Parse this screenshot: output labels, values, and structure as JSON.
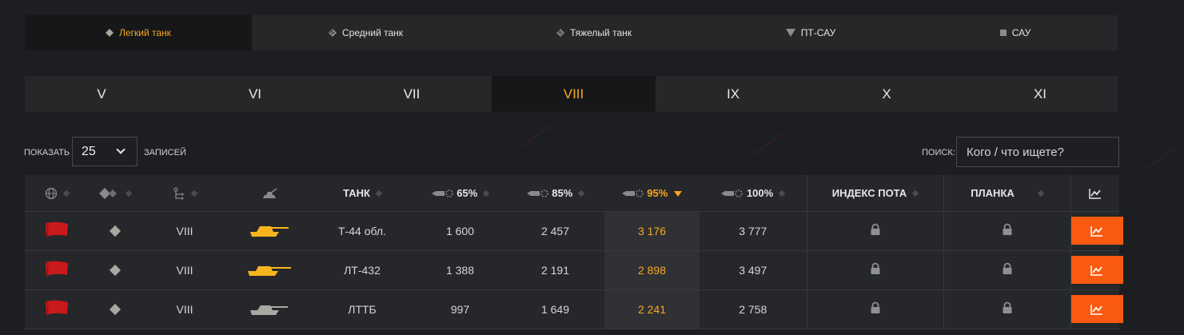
{
  "class_tabs": [
    {
      "label": "Легкий танк",
      "icon": "light-tank-diamond-icon",
      "active": true
    },
    {
      "label": "Средний танк",
      "icon": "medium-tank-icon",
      "active": false
    },
    {
      "label": "Тяжелый танк",
      "icon": "heavy-tank-icon",
      "active": false
    },
    {
      "label": "ПТ-САУ",
      "icon": "td-triangle-icon",
      "active": false
    },
    {
      "label": "САУ",
      "icon": "spg-square-icon",
      "active": false
    }
  ],
  "tier_tabs": [
    {
      "label": "V",
      "active": false
    },
    {
      "label": "VI",
      "active": false
    },
    {
      "label": "VII",
      "active": false
    },
    {
      "label": "VIII",
      "active": true
    },
    {
      "label": "IX",
      "active": false
    },
    {
      "label": "X",
      "active": false
    },
    {
      "label": "XI",
      "active": false
    }
  ],
  "controls": {
    "show_label": "ПОКАЗАТЬ",
    "page_size": "25",
    "records_label": "ЗАПИСЕЙ",
    "search_label": "ПОИСК:",
    "search_placeholder": "Кого / что ищете?"
  },
  "table": {
    "headers": {
      "nation": "",
      "type": "",
      "tier": "",
      "image": "",
      "tank": "ТАНК",
      "p65": "65%",
      "p85": "85%",
      "p95": "95%",
      "p100": "100%",
      "sweat_index": "ИНДЕКС ПОТА",
      "bar": "ПЛАНКА",
      "chart": ""
    },
    "sorted_column": "p95",
    "rows": [
      {
        "tier": "VIII",
        "tank": "Т-44 обл.",
        "p65": "1 600",
        "p85": "2 457",
        "p95": "3 176",
        "p100": "3 777",
        "tank_color": "#f6b41e"
      },
      {
        "tier": "VIII",
        "tank": "ЛТ-432",
        "p65": "1 388",
        "p85": "2 191",
        "p95": "2 898",
        "p100": "3 497",
        "tank_color": "#f6b41e"
      },
      {
        "tier": "VIII",
        "tank": "ЛТТБ",
        "p65": "997",
        "p85": "1 649",
        "p95": "2 241",
        "p100": "2 758",
        "tank_color": "#a9a89f"
      }
    ]
  },
  "colors": {
    "accent": "#f6a723",
    "button": "#fa5a10",
    "flag": "#c9191c"
  }
}
